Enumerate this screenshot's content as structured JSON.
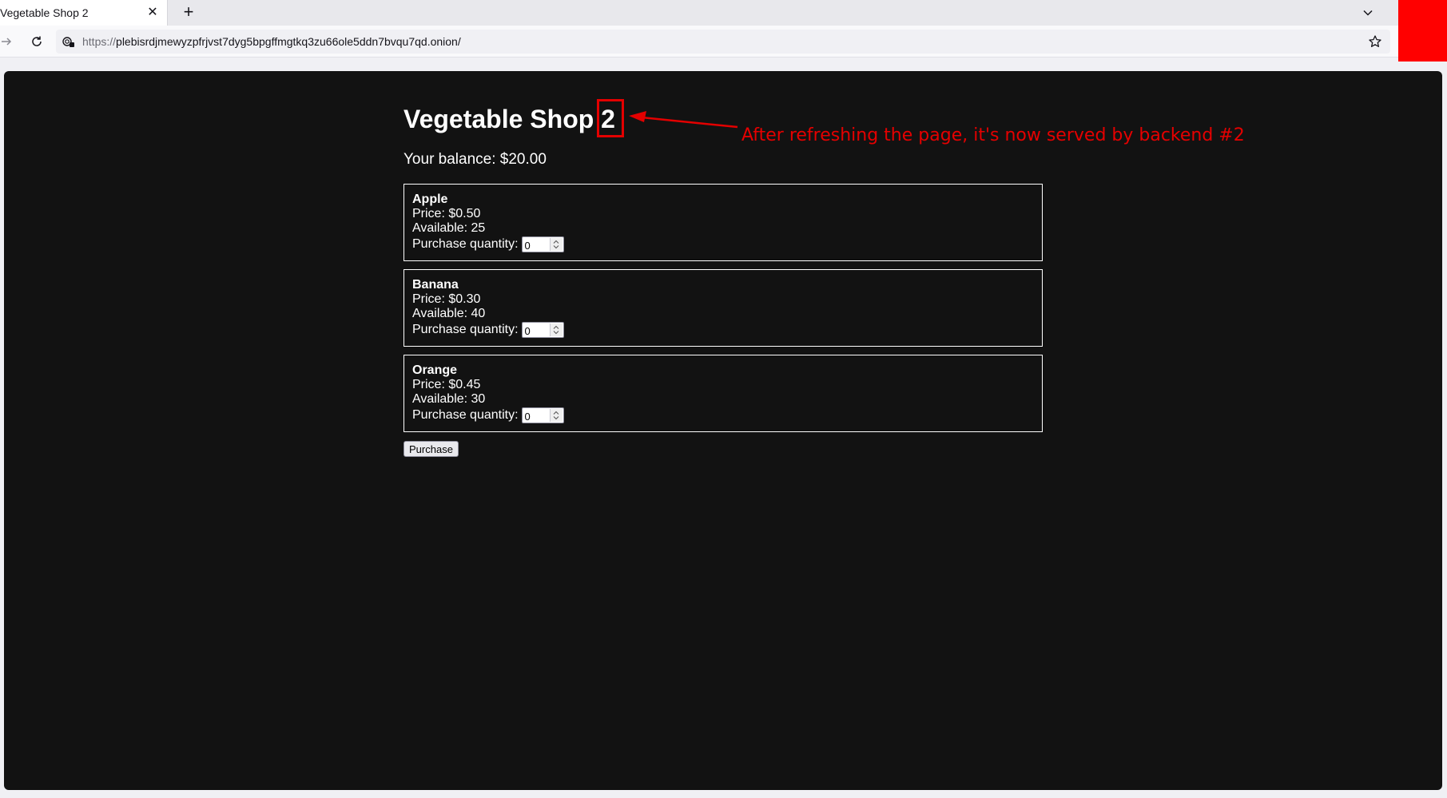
{
  "browser": {
    "tab_title": "Vegetable Shop 2",
    "close_glyph": "✕",
    "new_tab_glyph": "+",
    "url_scheme": "https://",
    "url_rest": "plebisrdjmewyzpfrjvst7dyg5bpgffmgtkq3zu66ole5ddn7bvqu7qd.onion/"
  },
  "page": {
    "title_text": "Vegetable Shop",
    "title_number": "2",
    "balance": "Your balance: $20.00",
    "purchase_label": "Purchase",
    "products": [
      {
        "name": "Apple",
        "price": "Price: $0.50",
        "available": "Available: 25",
        "qty_label": "Purchase quantity:",
        "qty": "0"
      },
      {
        "name": "Banana",
        "price": "Price: $0.30",
        "available": "Available: 40",
        "qty_label": "Purchase quantity:",
        "qty": "0"
      },
      {
        "name": "Orange",
        "price": "Price: $0.45",
        "available": "Available: 30",
        "qty_label": "Purchase quantity:",
        "qty": "0"
      }
    ]
  },
  "annotation": {
    "text": "After refreshing the page, it's now served by backend #2",
    "color": "#e50000"
  },
  "colors": {
    "page_bg": "#121212",
    "accent_block": "#ff0000"
  }
}
